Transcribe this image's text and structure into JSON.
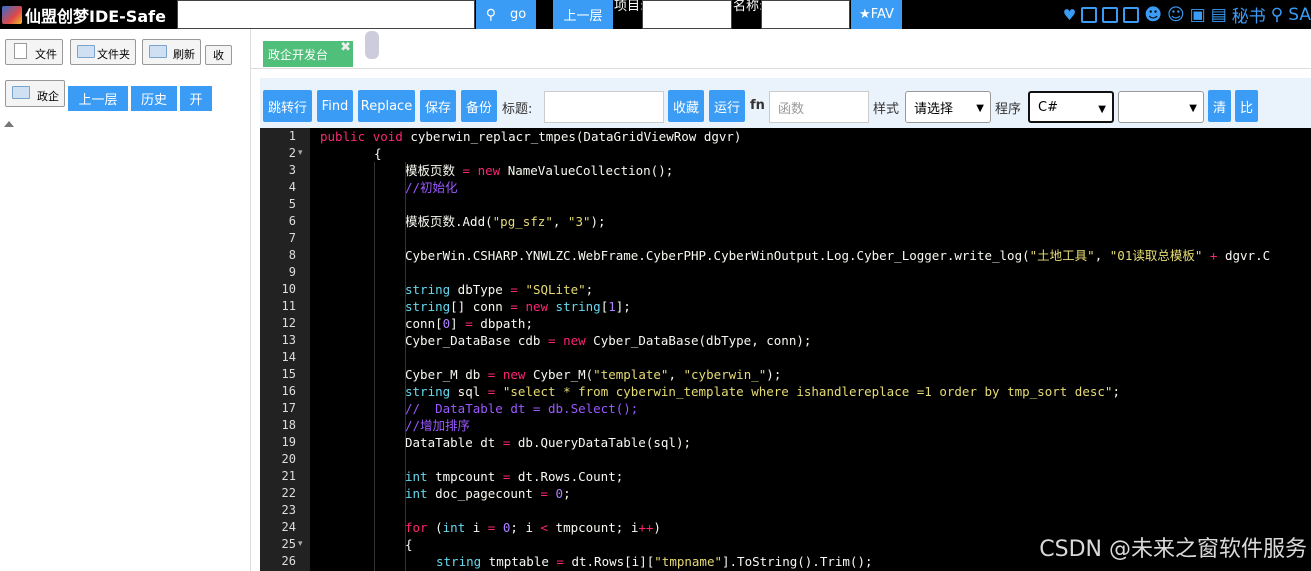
{
  "topbar": {
    "brand": "仙盟创梦IDE-Safe",
    "go_label": "go",
    "up_label": "上一层",
    "project_label": "项目:",
    "name_label": "名称:",
    "fav_label": "★FAV",
    "secretary_label": "秘书",
    "sa_label": "SA"
  },
  "left_panel": {
    "file_btn": "文件",
    "folder_btn": "文件夹",
    "refresh_btn": "刷新",
    "collapse_btn": "收",
    "zhengqi_btn": "政企",
    "up_btn": "上一层",
    "history_btn": "历史",
    "open_btn": "开"
  },
  "tabs": [
    {
      "label": "政企开发台"
    }
  ],
  "toolbar": {
    "goto_line": "跳转行",
    "find": "Find",
    "replace": "Replace",
    "save": "保存",
    "backup": "备份",
    "title_label": "标题:",
    "favorite": "收藏",
    "run": "运行",
    "fn_label": "fn",
    "fn_placeholder": "函数",
    "style_label": "样式",
    "style_value": "请选择",
    "program_label": "程序",
    "program_value": "C#",
    "clear": "清",
    "compare": "比"
  },
  "editor": {
    "lines": [
      {
        "n": "1",
        "fold": "",
        "indent": 0,
        "code": "public void cyberwin_replacr_tmpes(DataGridViewRow dgvr)"
      },
      {
        "n": "2",
        "fold": "▾",
        "indent": 1,
        "code": "{"
      },
      {
        "n": "3",
        "fold": "",
        "indent": 2,
        "code": "模板页数 = new NameValueCollection();"
      },
      {
        "n": "4",
        "fold": "",
        "indent": 2,
        "code": "//初始化"
      },
      {
        "n": "5",
        "fold": "",
        "indent": 2,
        "code": ""
      },
      {
        "n": "6",
        "fold": "",
        "indent": 2,
        "code": "模板页数.Add(\"pg_sfz\", \"3\");"
      },
      {
        "n": "7",
        "fold": "",
        "indent": 2,
        "code": ""
      },
      {
        "n": "8",
        "fold": "",
        "indent": 2,
        "code": "CyberWin.CSHARP.YNWLZC.WebFrame.CyberPHP.CyberWinOutput.Log.Cyber_Logger.write_log(\"土地工具\", \"01读取总模板\" + dgvr.C"
      },
      {
        "n": "9",
        "fold": "",
        "indent": 2,
        "code": ""
      },
      {
        "n": "10",
        "fold": "",
        "indent": 2,
        "code": "string dbType = \"SQLite\";"
      },
      {
        "n": "11",
        "fold": "",
        "indent": 2,
        "code": "string[] conn = new string[1];"
      },
      {
        "n": "12",
        "fold": "",
        "indent": 2,
        "code": "conn[0] = dbpath;"
      },
      {
        "n": "13",
        "fold": "",
        "indent": 2,
        "code": "Cyber_DataBase cdb = new Cyber_DataBase(dbType, conn);"
      },
      {
        "n": "14",
        "fold": "",
        "indent": 2,
        "code": ""
      },
      {
        "n": "15",
        "fold": "",
        "indent": 2,
        "code": "Cyber_M db = new Cyber_M(\"template\", \"cyberwin_\");"
      },
      {
        "n": "16",
        "fold": "",
        "indent": 2,
        "code": "string sql = \"select * from cyberwin_template where ishandlereplace =1 order by tmp_sort desc\";"
      },
      {
        "n": "17",
        "fold": "",
        "indent": 2,
        "code": "//  DataTable dt = db.Select();"
      },
      {
        "n": "18",
        "fold": "",
        "indent": 2,
        "code": "//增加排序"
      },
      {
        "n": "19",
        "fold": "",
        "indent": 2,
        "code": "DataTable dt = db.QueryDataTable(sql);"
      },
      {
        "n": "20",
        "fold": "",
        "indent": 2,
        "code": ""
      },
      {
        "n": "21",
        "fold": "",
        "indent": 2,
        "code": "int tmpcount = dt.Rows.Count;"
      },
      {
        "n": "22",
        "fold": "",
        "indent": 2,
        "code": "int doc_pagecount = 0;"
      },
      {
        "n": "23",
        "fold": "",
        "indent": 2,
        "code": ""
      },
      {
        "n": "24",
        "fold": "",
        "indent": 2,
        "code": "for (int i = 0; i < tmpcount; i++)"
      },
      {
        "n": "25",
        "fold": "▾",
        "indent": 2,
        "code": "{"
      },
      {
        "n": "26",
        "fold": "",
        "indent": 3,
        "code": "string tmptable = dt.Rows[i][\"tmpname\"].ToString().Trim();"
      }
    ]
  },
  "watermark": "CSDN @未来之窗软件服务"
}
